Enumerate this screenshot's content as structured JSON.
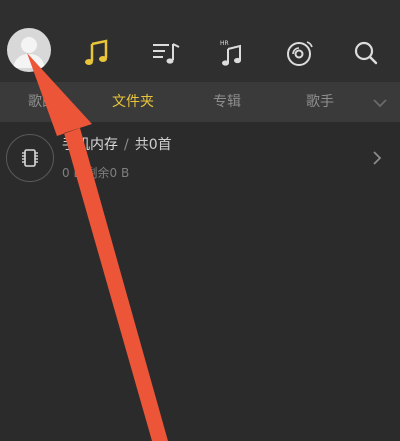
{
  "header": {
    "icons": [
      "avatar-icon",
      "music-note-icon",
      "playlist-icon",
      "hr-music-icon",
      "radio-disc-icon",
      "search-icon"
    ],
    "active_color": "#e9c53a"
  },
  "tabs": [
    {
      "label": "歌曲",
      "active": false
    },
    {
      "label": "文件夹",
      "active": true
    },
    {
      "label": "专辑",
      "active": false
    },
    {
      "label": "歌手",
      "active": false
    }
  ],
  "storage_row": {
    "title": "手机内存",
    "separator": "/",
    "count": "共0首",
    "subtitle": "0 B,剩余0 B"
  },
  "overlay": {
    "arrow_color": "#ec5538"
  }
}
